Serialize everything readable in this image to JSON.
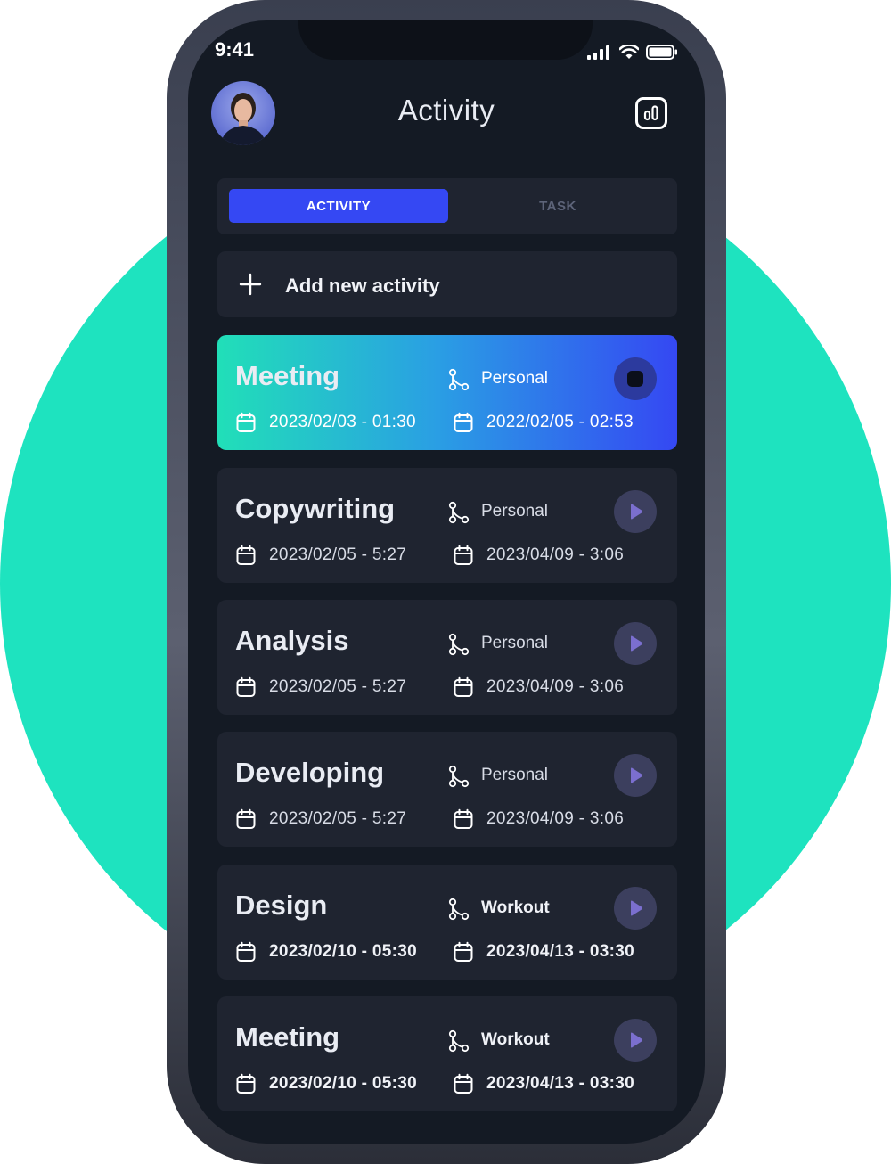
{
  "status": {
    "time": "9:41"
  },
  "header": {
    "title": "Activity"
  },
  "tabs": [
    {
      "label": "ACTIVITY",
      "active": true
    },
    {
      "label": "TASK",
      "active": false
    }
  ],
  "add_activity": {
    "label": "Add new activity"
  },
  "colors": {
    "accent": "#3548f3",
    "background_circle": "#1ee3bf",
    "card_bg": "#1f2430",
    "screen_bg": "#141a24",
    "play_button": "#3c3f5e",
    "play_icon": "#7b6fcf"
  },
  "activities": [
    {
      "title": "Meeting",
      "category": "Personal",
      "start": "2023/02/03 - 01:30",
      "end": "2022/02/05 - 02:53",
      "state": "recording",
      "icon": "stop-icon"
    },
    {
      "title": "Copywriting",
      "category": "Personal",
      "start": "2023/02/05 - 5:27",
      "end": "2023/04/09 - 3:06",
      "state": "idle",
      "icon": "play-icon"
    },
    {
      "title": "Analysis",
      "category": "Personal",
      "start": "2023/02/05 - 5:27",
      "end": "2023/04/09 - 3:06",
      "state": "idle",
      "icon": "play-icon"
    },
    {
      "title": "Developing",
      "category": "Personal",
      "start": "2023/02/05 - 5:27",
      "end": "2023/04/09 - 3:06",
      "state": "idle",
      "icon": "play-icon"
    },
    {
      "title": "Design",
      "category": "Workout",
      "start": "2023/02/10 - 05:30",
      "end": "2023/04/13 - 03:30",
      "state": "idle",
      "icon": "play-icon"
    },
    {
      "title": "Meeting",
      "category": "Workout",
      "start": "2023/02/10 - 05:30",
      "end": "2023/04/13 - 03:30",
      "state": "idle",
      "icon": "play-icon"
    }
  ]
}
